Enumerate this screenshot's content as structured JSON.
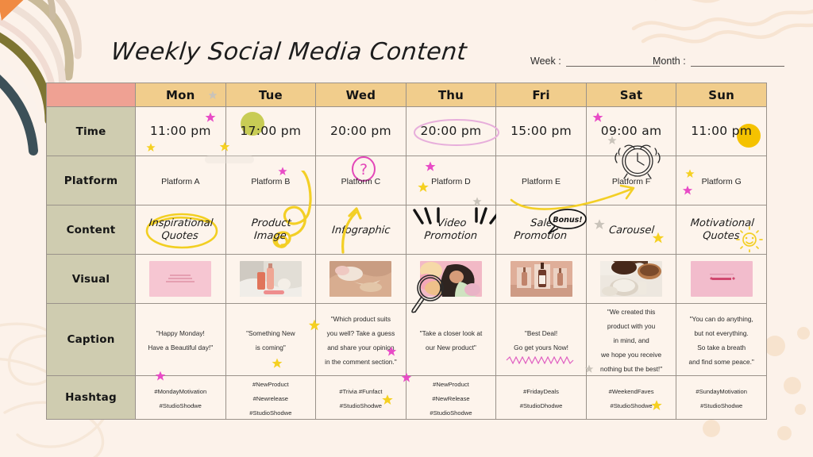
{
  "page": {
    "title": "Weekly Social Media Content",
    "background_color": "#FCF2EA"
  },
  "meta_fields": [
    {
      "label": "Week :",
      "value": ""
    },
    {
      "label": "Month :",
      "value": ""
    }
  ],
  "table": {
    "corner_label": "",
    "day_headers": [
      "Mon",
      "Tue",
      "Wed",
      "Thu",
      "Fri",
      "Sat",
      "Sun"
    ],
    "row_labels": [
      "Time",
      "Platform",
      "Content",
      "Visual",
      "Caption",
      "Hashtag"
    ],
    "colors": {
      "corner": "#EFA193",
      "day_header": "#F1CD8C",
      "row_label": "#CFCCB0",
      "cell": "#FDF4EC",
      "border": "#9A928A"
    },
    "rows": {
      "time": [
        "11:00 pm",
        "17:00 pm",
        "20:00 pm",
        "20:00 pm",
        "15:00 pm",
        "09:00 am",
        "11:00 pm"
      ],
      "platform": [
        "Platform A",
        "Platform B",
        "Platform C",
        "Platform D",
        "Platform E",
        "Platform F",
        "Platform G"
      ],
      "content": [
        "Inspirational\nQuotes",
        "Product\nImage",
        "Infographic",
        "Video\nPromotion",
        "Sale\nPromotion",
        "Carousel",
        "Motivational\nQuotes"
      ],
      "visual_alt": [
        "pink-quote-card",
        "skincare-bottles-on-bed",
        "hand-with-cream-swatch",
        "woman-lying-with-flowers",
        "three-serum-bottles",
        "pouring-coffee-beans",
        "pink-love-card"
      ],
      "caption": [
        "\"Happy Monday!\nHave a Beautiful day!\"",
        "\"Something New\nis coming\"",
        "\"Which product suits\nyou well? Take a guess\nand share your opinion\nin the comment section.\"",
        "\"Take a closer look at\nour New product\"",
        "\"Best Deal!\nGo get yours Now!",
        "\"We created this\nproduct with you\nin mind, and\nwe hope you receive\nnothing but the best!\"",
        "\"You can do anything,\nbut not everything.\nSo take a breath\nand find some peace.\""
      ],
      "hashtag": [
        "#MondayMotivation\n#StudioShodwe",
        "#NewProduct\n#Newrelease\n#StudioShodwe",
        "#Trivia #Funfact\n#StudioShodwe",
        "#NewProduct\n#NewRelease\n#StudioShodwe",
        "#FridayDeals\n#StudioDhodwe",
        "#WeekendFaves\n#StudioShodwe",
        "#SundayMotivation\n#StudioShodwe"
      ]
    }
  },
  "doodles": {
    "yellow_circle_tue_time": "filled-olive-yellow-dot",
    "yellow_circle_sun_time": "filled-gold-dot",
    "pink_oval_thu_time": "hand-drawn-oval-highlight",
    "question_mark_wed": "circled-question-mark",
    "arrow_wed_up": "yellow-curved-up-arrow",
    "arrow_fri_to_sat": "yellow-curved-arrow",
    "alarm_clock_sat": "alarm-clock-sketch",
    "yellow_oval_mon_content": "hand-drawn-oval-highlight",
    "yellow_squiggle_tue_content": "yellow-loop-squiggle",
    "burst_thu_content": "ink-burst-lines",
    "bonus_badge_fri": "Bonus!",
    "sun_sun_content": "sun-doodle",
    "magnifier_thu_visual": "magnifying-glass-sketch",
    "pink_zigzag_fri_caption": "pink-zigzag-underline"
  },
  "accents": {
    "pink_star": "#E84BC6",
    "yellow_star": "#F5D021",
    "gray_star": "#C9C3BA",
    "gold": "#F2C200",
    "olive": "#C8CC55",
    "magenta": "#E347B8",
    "ink": "#141414"
  }
}
